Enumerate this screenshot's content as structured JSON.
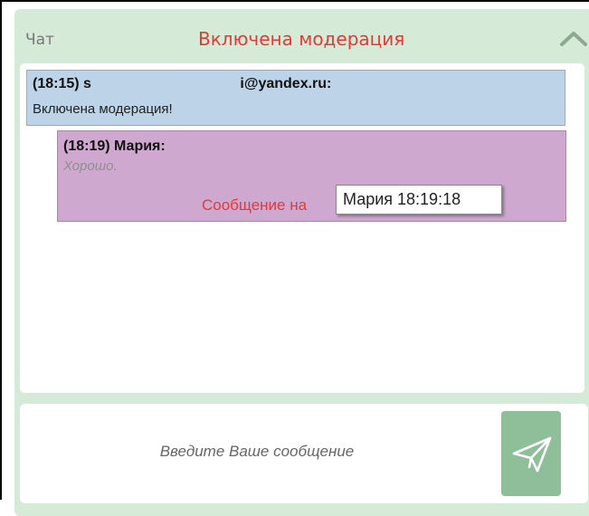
{
  "header": {
    "chat_label": "Чат",
    "moderation_title": "Включена модерация",
    "collapse_icon": "chevron-up-icon"
  },
  "messages": [
    {
      "header": "(18:15) s                                     i@yandex.ru:",
      "body": "Включена модерация!"
    },
    {
      "header": "(18:19) Мария:",
      "body": "Хорошо.",
      "status": "Сообщение на"
    }
  ],
  "tooltip": {
    "text": "Мария 18:19:18"
  },
  "composer": {
    "placeholder": "Введите Ваше сообщение",
    "send_icon": "paper-plane-icon"
  },
  "colors": {
    "panel_bg": "#d6ebd7",
    "system_msg_bg": "#bcd3e8",
    "user_msg_bg": "#cfa8cf",
    "alert_red": "#e53935",
    "send_button_bg": "#8fbf98"
  }
}
